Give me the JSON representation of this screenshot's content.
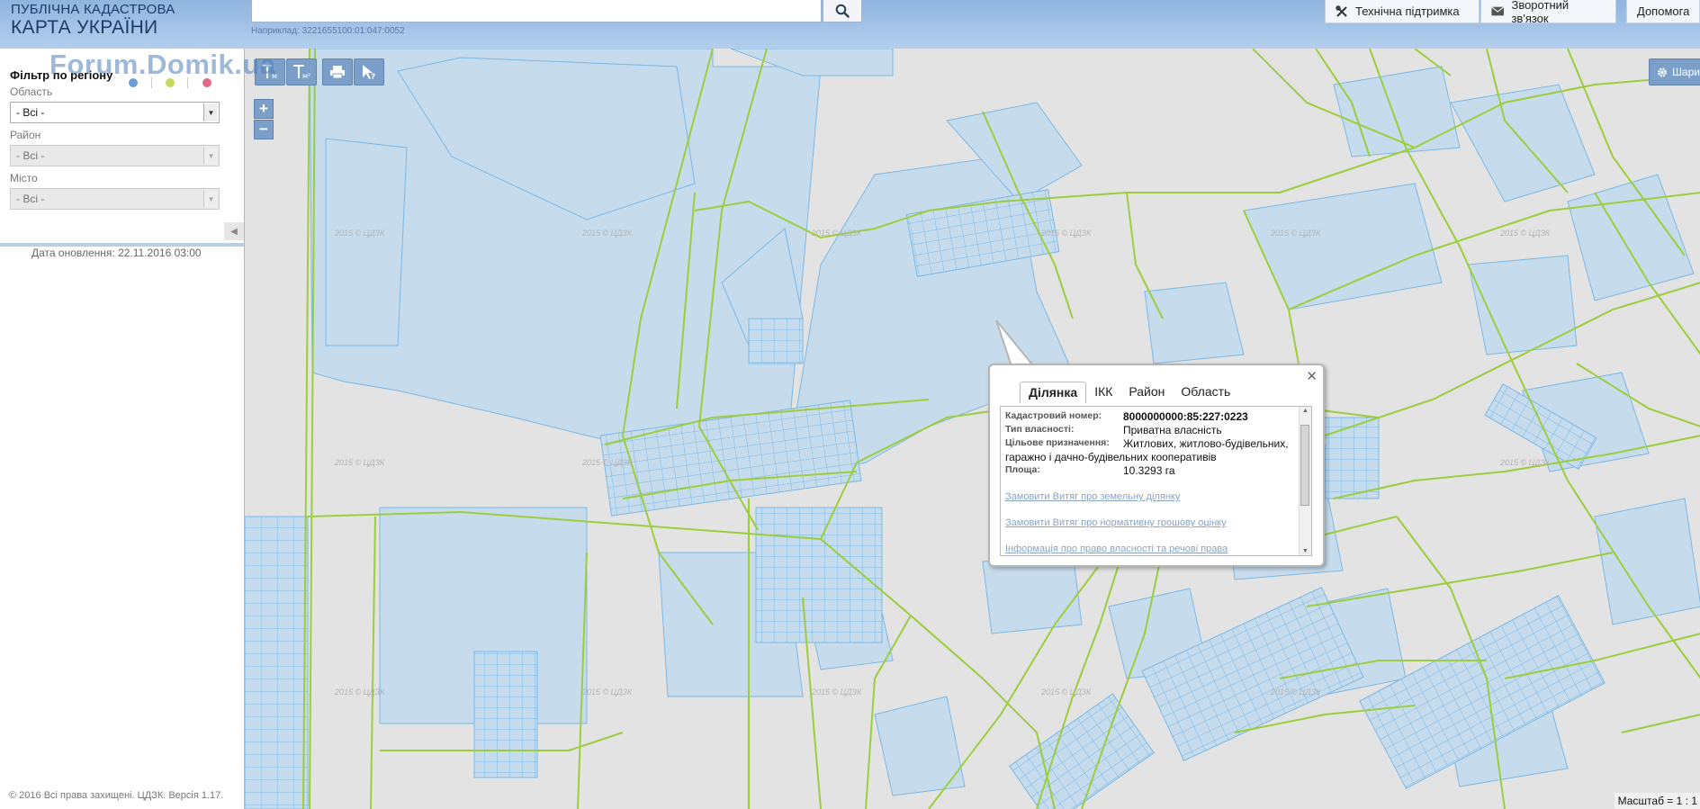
{
  "header": {
    "title_line1": "ПУБЛІЧНА КАДАСТРОВА",
    "title_line2": "КАРТА УКРАЇНИ",
    "search": {
      "value": "",
      "placeholder": "",
      "hint": "Наприклад: 3221655100:01:047:0052"
    },
    "buttons": [
      {
        "label": "Технічна підтримка",
        "icon": "tools-icon"
      },
      {
        "label": "Зворотний зв'язок",
        "icon": "envelope-icon"
      },
      {
        "label": "Допомога"
      }
    ]
  },
  "sidebar": {
    "watermark": "Forum.Domik.ua",
    "filter_title": "Фільтр по регіону",
    "legend_dots": [
      "#6a9fd4",
      "#c7d95a",
      "#dd6b8a"
    ],
    "fields": [
      {
        "label": "Область",
        "value": "- Всі -",
        "disabled": false
      },
      {
        "label": "Район",
        "value": "- Всі -",
        "disabled": true
      },
      {
        "label": "Місто",
        "value": "- Всі -",
        "disabled": true
      }
    ],
    "update_date": "Дата оновлення: 22.11.2016 03:00",
    "copyright": "© 2016 Всі права захищені. ЦДЗК. Версія 1.17."
  },
  "map": {
    "layers_button": "Шари",
    "scale": "Масштаб = 1 : 1",
    "tile_watermark": "2015 © ЦДЗК",
    "colors": {
      "background": "#e3e3e3",
      "parcel_fill": "#c6dced",
      "parcel_stroke": "#7ab8e6",
      "boundary": "#9ccd3c",
      "tool_button": "#7b9fc9"
    }
  },
  "popup": {
    "tabs": [
      "Ділянка",
      "ІКК",
      "Район",
      "Область"
    ],
    "active_tab": 0,
    "fields": [
      {
        "key": "Кадастровий номер:",
        "value": "8000000000:85:227:0223",
        "bold": true
      },
      {
        "key": "Тип власності:",
        "value": "Приватна власність"
      },
      {
        "key": "Цільове призначення:",
        "value": "Житлових, житлово-будівельних,",
        "value_cont": "гаражно і дачно-будівельних кооперативів"
      },
      {
        "key": "Площа:",
        "value": "10.3293 га"
      }
    ],
    "links": [
      "Замовити Витяг про земельну ділянку",
      "Замовити Витяг про нормативну грошову оцінку",
      "Інформація про право власності та речові права"
    ]
  }
}
